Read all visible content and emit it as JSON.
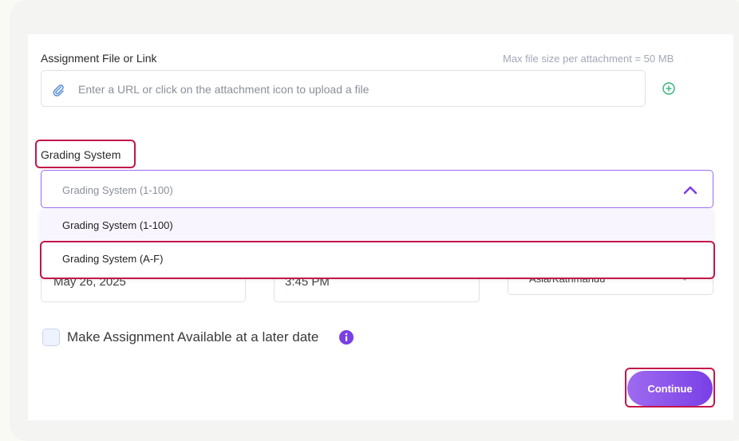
{
  "assignment": {
    "label": "Assignment File or Link",
    "max_size_hint": "Max file size per attachment = 50 MB",
    "input_placeholder": "Enter a URL or click on the attachment icon to upload a file"
  },
  "grading": {
    "label": "Grading System",
    "selected_placeholder": "Grading System (1-100)",
    "options": [
      "Grading System (1-100)",
      "Grading System (A-F)"
    ]
  },
  "schedule": {
    "date_value": "May 26, 2025",
    "time_value": "3:45 PM",
    "timezone_value": "Asia/Kathmandu"
  },
  "availability": {
    "checkbox_label": "Make Assignment Available at a later date"
  },
  "actions": {
    "continue_label": "Continue"
  },
  "colors": {
    "accent": "#7a3fe6",
    "annotation": "#c2164a",
    "add_icon": "#2fb37a"
  },
  "icons": [
    "paperclip-icon",
    "add-circle-icon",
    "chevron-up-icon",
    "chevron-down-icon",
    "info-icon"
  ]
}
